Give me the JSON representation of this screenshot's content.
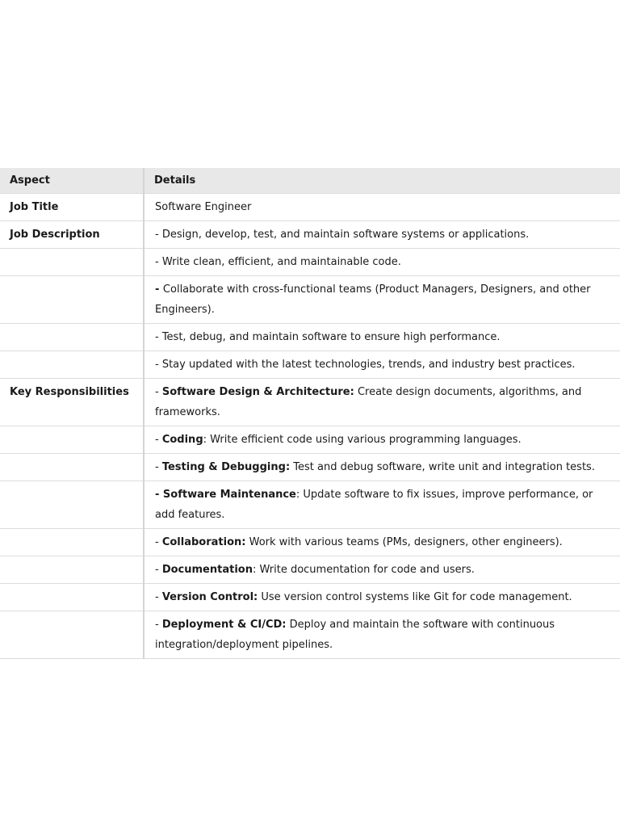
{
  "table": {
    "headers": [
      "Aspect",
      "Details"
    ],
    "rows": [
      {
        "aspect": "Job Title",
        "prefix": "",
        "bold": "",
        "text": "Software Engineer"
      },
      {
        "aspect": "Job Description",
        "prefix": "- ",
        "bold": "",
        "text": "Design, develop, test, and maintain software systems or applications."
      },
      {
        "aspect": "",
        "prefix": "- ",
        "bold": "",
        "text": "Write clean, efficient, and maintainable code."
      },
      {
        "aspect": "",
        "prefix": "- ",
        "bold": "",
        "text": "Collaborate with cross-functional teams (Product Managers, Designers, and other Engineers)."
      },
      {
        "aspect": "",
        "prefix": "- ",
        "bold": "",
        "text": "Test, debug, and maintain software to ensure high performance."
      },
      {
        "aspect": "",
        "prefix": "- ",
        "bold": "",
        "text": "Stay updated with the latest technologies, trends, and industry best practices."
      },
      {
        "aspect": "Key Responsibilities",
        "prefix": "- ",
        "bold": "Software Design & Architecture:",
        "text": " Create design documents, algorithms, and frameworks."
      },
      {
        "aspect": "",
        "prefix": "- ",
        "bold": "Coding",
        "text": ": Write efficient code using various programming languages."
      },
      {
        "aspect": "",
        "prefix": "- ",
        "bold": "Testing & Debugging:",
        "text": " Test and debug software, write unit and integration tests."
      },
      {
        "aspect": "",
        "prefix": "- ",
        "bold": "Software Maintenance",
        "text": ": Update software to fix issues, improve performance, or add features."
      },
      {
        "aspect": "",
        "prefix": "- ",
        "bold": "Collaboration:",
        "text": " Work with various teams (PMs, designers, other engineers)."
      },
      {
        "aspect": "",
        "prefix": "- ",
        "bold": "Documentation",
        "text": ": Write documentation for code and users."
      },
      {
        "aspect": "",
        "prefix": "- ",
        "bold": "Version Control:",
        "text": " Use version control systems like Git for code management."
      },
      {
        "aspect": "",
        "prefix": "- ",
        "bold": "Deployment & CI/CD:",
        "text": " Deploy and maintain the software with continuous integration/deployment pipelines."
      }
    ]
  }
}
